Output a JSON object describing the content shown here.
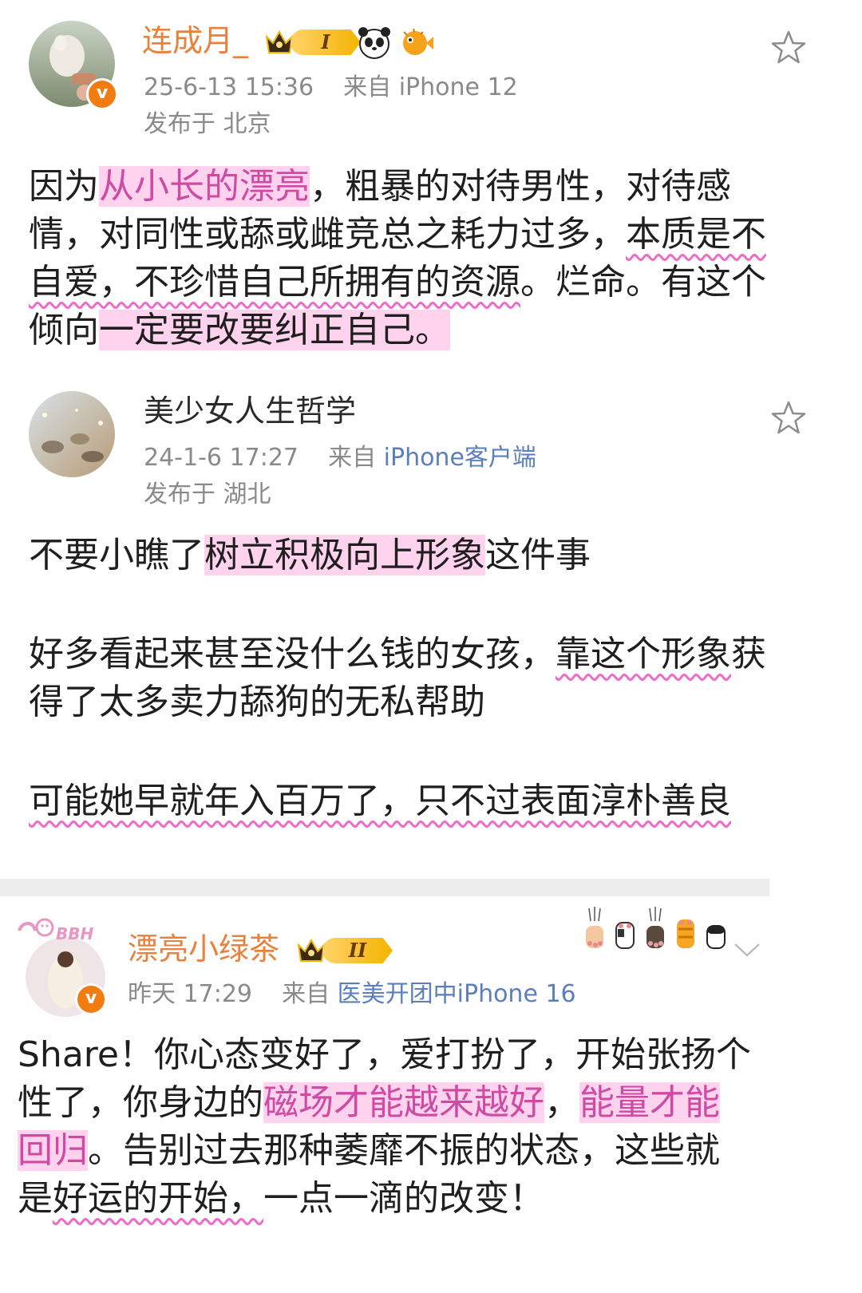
{
  "posts": [
    {
      "username": "连成月_",
      "level_badge": "I",
      "time": "25-6-13 15:36",
      "source_prefix": "来自",
      "source": "iPhone 12",
      "location": "发布于 北京",
      "verified_mark": "v",
      "icons": [
        "crown-icon",
        "panda-icon",
        "pufferfish-icon"
      ],
      "body": [
        {
          "text": "因为",
          "style": "plain"
        },
        {
          "text": "从小长的漂亮",
          "style": "highlight"
        },
        {
          "text": "，粗暴的对待男性，对待感情，对同性或舔或雌竞总之耗力过多，",
          "style": "plain"
        },
        {
          "text": "本质是不自爱，不珍惜自己所拥有的资源",
          "style": "wavy"
        },
        {
          "text": "。烂命。有这个倾向",
          "style": "plain"
        },
        {
          "text": "一定要改要纠正自己。",
          "style": "highlight-dark"
        }
      ]
    },
    {
      "username": "美少女人生哲学",
      "time": "24-1-6 17:27",
      "source_prefix": "来自",
      "source": "iPhone客户端",
      "location": "发布于 湖北",
      "icons": [
        "star-outline-icon"
      ],
      "paragraphs": [
        [
          {
            "text": "不要小瞧了",
            "style": "plain"
          },
          {
            "text": "树立积极向上形象",
            "style": "highlight-dark"
          },
          {
            "text": "这件事",
            "style": "plain"
          }
        ],
        [
          {
            "text": "好多看起来甚至没什么钱的女孩，",
            "style": "plain"
          },
          {
            "text": "靠这个形象",
            "style": "wavy"
          },
          {
            "text": "获得了太多卖力舔狗的无私帮助",
            "style": "plain"
          }
        ],
        [
          {
            "text": "可能她早就年入百万了，只不过表面淳朴善良",
            "style": "wavy"
          }
        ]
      ]
    },
    {
      "username": "漂亮小绿茶",
      "level_badge": "II",
      "time": "昨天 17:29",
      "source_prefix": "来自",
      "source": "医美开团中iPhone 16",
      "verified_mark": "v",
      "avatar_frame_text": "BBH",
      "icons": [
        "crown-icon",
        "cat-paws-icon",
        "chevron-down-icon"
      ],
      "body": [
        {
          "text": "Share！你心态变好了，爱打扮了，开始张扬个性了，你身边的",
          "style": "plain"
        },
        {
          "text": "磁场才能越来越好",
          "style": "highlight"
        },
        {
          "text": "，",
          "style": "plain"
        },
        {
          "text": "能量才能回归",
          "style": "highlight"
        },
        {
          "text": "。告别过去那种萎靡不振的状态，这些就是",
          "style": "plain"
        },
        {
          "text": "好运的开始，",
          "style": "wavy"
        },
        {
          "text": "一点一滴的改变！",
          "style": "plain"
        }
      ]
    }
  ],
  "colors": {
    "username_orange": "#e8813c",
    "highlight_bg": "#ffd3ee",
    "highlight_text": "#cf4aa3",
    "wavy_underline": "#f06ac7",
    "meta_gray": "#8a8a8a",
    "source_blue": "#5b7fbe"
  }
}
